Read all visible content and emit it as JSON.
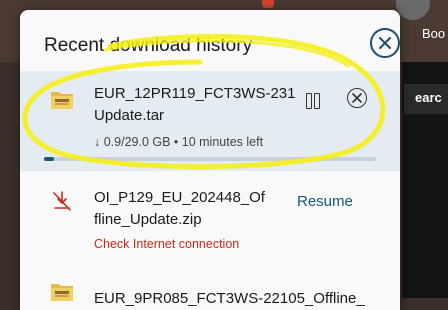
{
  "background": {
    "header_text": "Boo",
    "search_text": "earc"
  },
  "panel": {
    "title": "Recent download history",
    "close_icon": "close-circle-icon"
  },
  "downloads": [
    {
      "filename_line1": "EUR_12PR119_FCT3WS-231",
      "filename_line2": "Update.tar",
      "status": "↓ 0.9/29.0 GB • 10 minutes left",
      "progress": 0.031,
      "icon": "folder-archive-icon",
      "actions": [
        "pause",
        "cancel"
      ]
    },
    {
      "filename_line1": "OI_P129_EU_202448_Of",
      "filename_line2": "fline_Update.zip",
      "status": "Check Internet connection",
      "action_label": "Resume",
      "icon": "download-error-icon"
    },
    {
      "filename_line1": "EUR_9PR085_FCT3WS-22105_Offline_",
      "icon": "folder-archive-icon"
    }
  ],
  "colors": {
    "accent": "#14587a",
    "error": "#c42b1c",
    "highlight": "#f4f01a",
    "selected_row": "#e4ebf1"
  }
}
